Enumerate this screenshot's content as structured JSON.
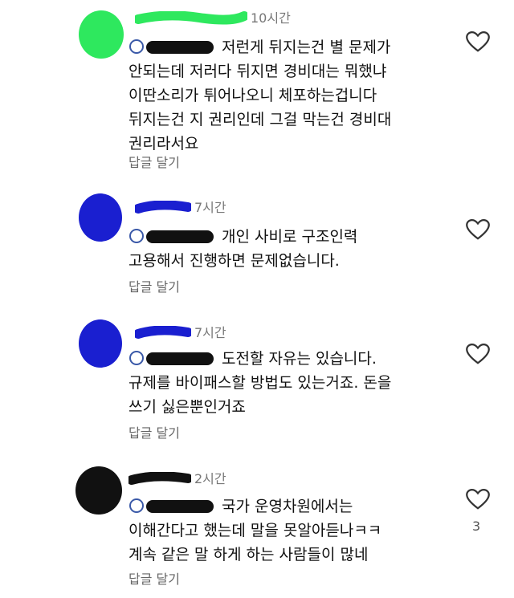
{
  "comments": [
    {
      "time": "10시간",
      "lines": [
        "저런게 뒤지는건 별 문제가",
        "안되는데 저러다 뒤지면 경비대는 뭐했냐",
        "이딴소리가 튀어나오니 체포하는겁니다",
        "뒤지는건 지 권리인데 그걸 막는건 경비대",
        "권리라서요"
      ],
      "reply_label": "답글 달기",
      "avatar_color": "#2ee85e",
      "likes": ""
    },
    {
      "time": "7시간",
      "lines": [
        "개인 사비로 구조인력",
        "고용해서 진행하면 문제없습니다."
      ],
      "reply_label": "답글 달기",
      "avatar_color": "#1a1fd0",
      "likes": ""
    },
    {
      "time": "7시간",
      "lines": [
        "도전할 자유는 있습니다.",
        "규제를 바이패스할 방법도 있는거죠. 돈을",
        "쓰기 싫은뿐인거죠"
      ],
      "reply_label": "답글 달기",
      "avatar_color": "#1a1fd0",
      "likes": ""
    },
    {
      "time": "2시간",
      "lines": [
        "국가 운영차원에서는",
        "이해간다고 했는데 말을 못알아듣나ㅋㅋ",
        "계속 같은 말 하게 하는 사람들이 많네"
      ],
      "reply_label": "답글 달기",
      "avatar_color": "#111111",
      "likes": "3"
    }
  ]
}
